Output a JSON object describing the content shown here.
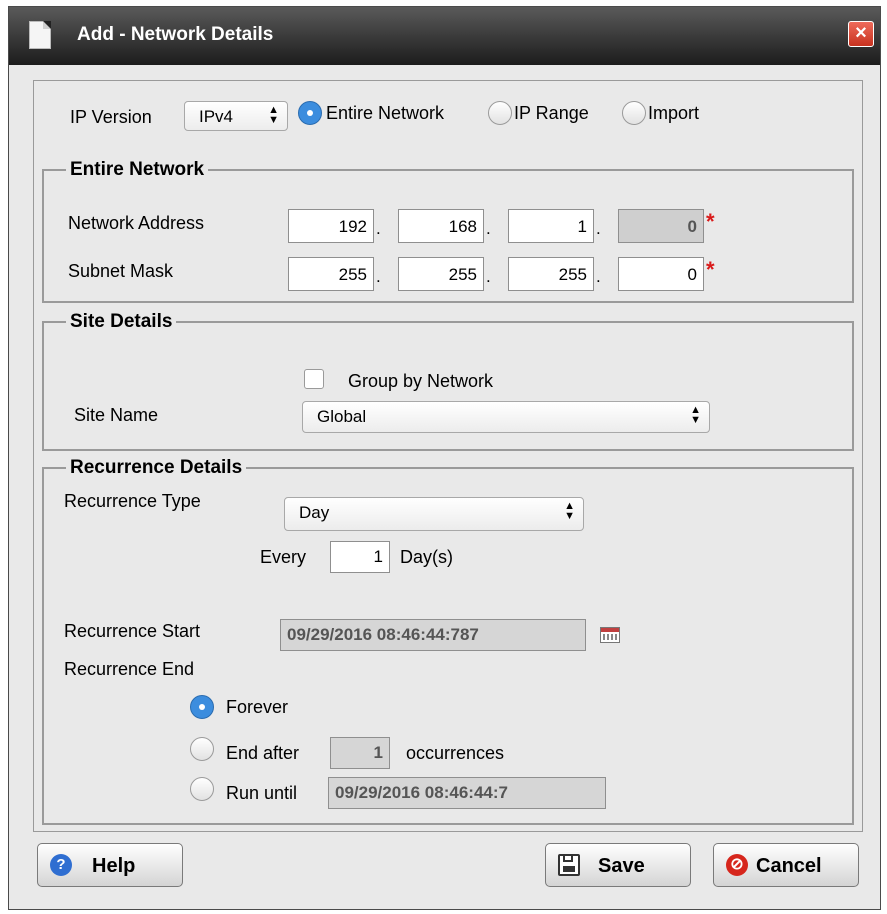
{
  "window": {
    "title": "Add - Network Details",
    "close_glyph": "×"
  },
  "ip_version": {
    "label": "IP Version",
    "selected": "IPv4",
    "options": [
      {
        "label": "Entire Network",
        "selected": true
      },
      {
        "label": "IP Range",
        "selected": false
      },
      {
        "label": "Import",
        "selected": false
      }
    ]
  },
  "entire_network": {
    "legend": "Entire Network",
    "network_address": {
      "label": "Network Address",
      "octets": [
        "192",
        "168",
        "1",
        "0"
      ]
    },
    "subnet_mask": {
      "label": "Subnet Mask",
      "octets": [
        "255",
        "255",
        "255",
        "0"
      ]
    },
    "required_mark": "*"
  },
  "site_details": {
    "legend": "Site Details",
    "group_by_network": {
      "label": "Group by Network",
      "checked": false
    },
    "site_name": {
      "label": "Site Name",
      "selected": "Global"
    }
  },
  "recurrence": {
    "legend": "Recurrence Details",
    "type": {
      "label": "Recurrence Type",
      "selected": "Day"
    },
    "every": {
      "label": "Every",
      "value": "1",
      "unit": "Day(s)"
    },
    "start": {
      "label": "Recurrence Start",
      "value": "09/29/2016 08:46:44:787"
    },
    "end": {
      "label": "Recurrence End",
      "forever": {
        "label": "Forever",
        "selected": true
      },
      "end_after": {
        "label": "End after",
        "value": "1",
        "suffix": "occurrences",
        "selected": false
      },
      "run_until": {
        "label": "Run until",
        "value": "09/29/2016 08:46:44:7",
        "selected": false
      }
    }
  },
  "buttons": {
    "help": "Help",
    "save": "Save",
    "cancel": "Cancel"
  },
  "icons": {
    "help": "?",
    "cancel": "⊘",
    "select_arrows": "▲▼"
  },
  "colors": {
    "accent_radio": "#3c8dde",
    "required": "#d91a1a",
    "close": "#d9402e"
  }
}
